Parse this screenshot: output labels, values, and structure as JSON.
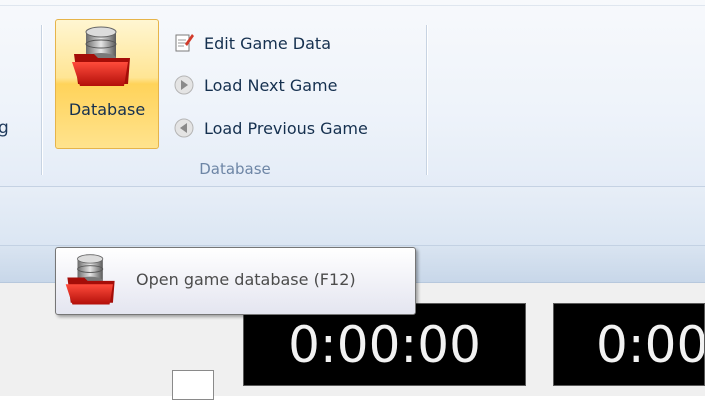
{
  "ribbon": {
    "cut_label": "g",
    "database_button": {
      "label": "Database",
      "icon": "database-icon"
    },
    "menu_items": [
      {
        "label": "Edit Game Data",
        "icon": "edit-icon"
      },
      {
        "label": "Load Next Game",
        "icon": "next-icon"
      },
      {
        "label": "Load Previous Game",
        "icon": "previous-icon"
      }
    ],
    "group_label": "Database"
  },
  "tooltip": {
    "text": "Open game database (F12)",
    "icon": "database-icon"
  },
  "clocks": {
    "white": "0:00:00",
    "black": "0:00"
  },
  "colors": {
    "button_highlight": "#ffd35a",
    "ribbon_text": "#15304f",
    "group_label": "#6e86a6",
    "clock_bg": "#000000"
  }
}
